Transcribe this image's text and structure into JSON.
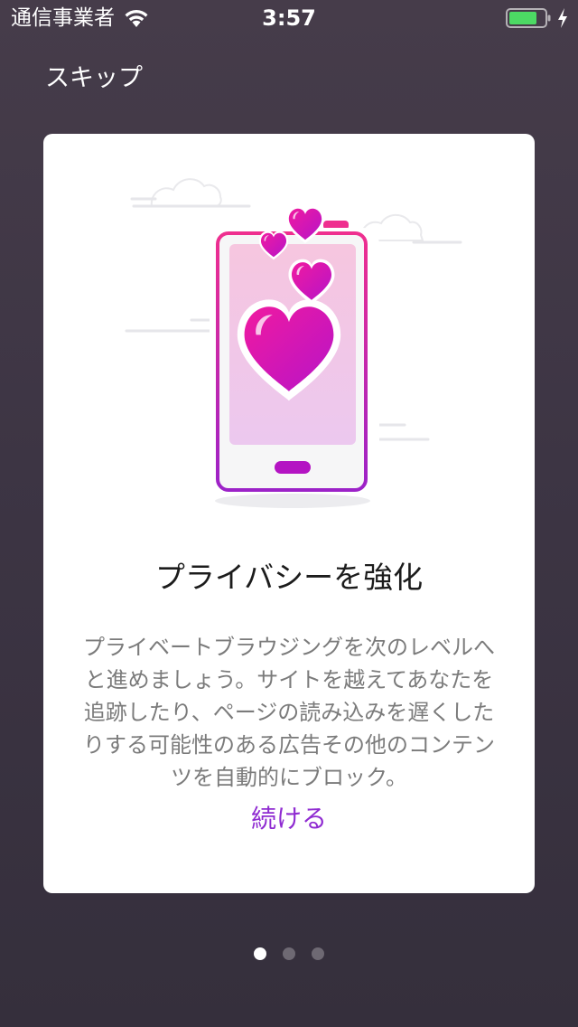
{
  "status_bar": {
    "carrier": "通信事業者",
    "time": "3:57",
    "battery_color": "#4cd964",
    "icons": [
      "wifi-icon",
      "battery-icon",
      "charging-icon"
    ]
  },
  "header": {
    "skip_label": "スキップ"
  },
  "card": {
    "illustration": "phone-hearts-illustration",
    "title": "プライバシーを強化",
    "body": "プライベートブラウジングを次のレベルへと進めましょう。サイトを越えてあなたを追跡したり、ページの読み込みを遅くしたりする可能性のある広告その他のコンテンツを自動的にブロック。",
    "continue_label": "続ける",
    "accent_color": "#8f2bd1",
    "heart_color": "#e8119e"
  },
  "pagination": {
    "total": 3,
    "current": 1
  }
}
